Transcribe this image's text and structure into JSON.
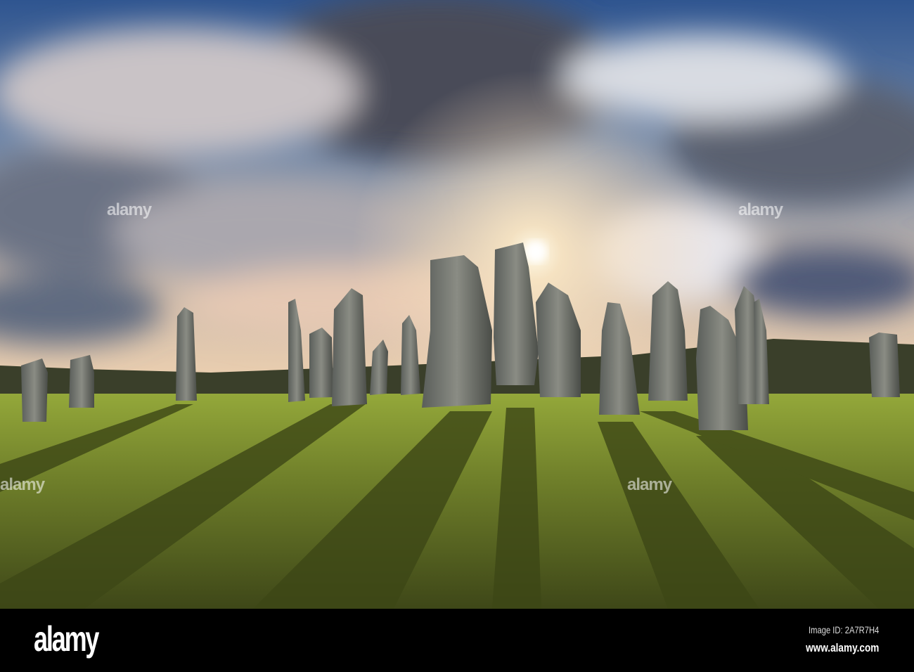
{
  "photo": {
    "subject": "Callanish standing stones at sunset",
    "colors": {
      "sky_blue": "#3a5f9a",
      "sun": "#fff6d8",
      "grass": "#7b8f2a",
      "stone": "#6f716a"
    }
  },
  "watermark": {
    "text": "alamy"
  },
  "footer": {
    "logo": "alamy",
    "image_id": "Image ID: 2A7R7H4",
    "url": "www.alamy.com"
  }
}
